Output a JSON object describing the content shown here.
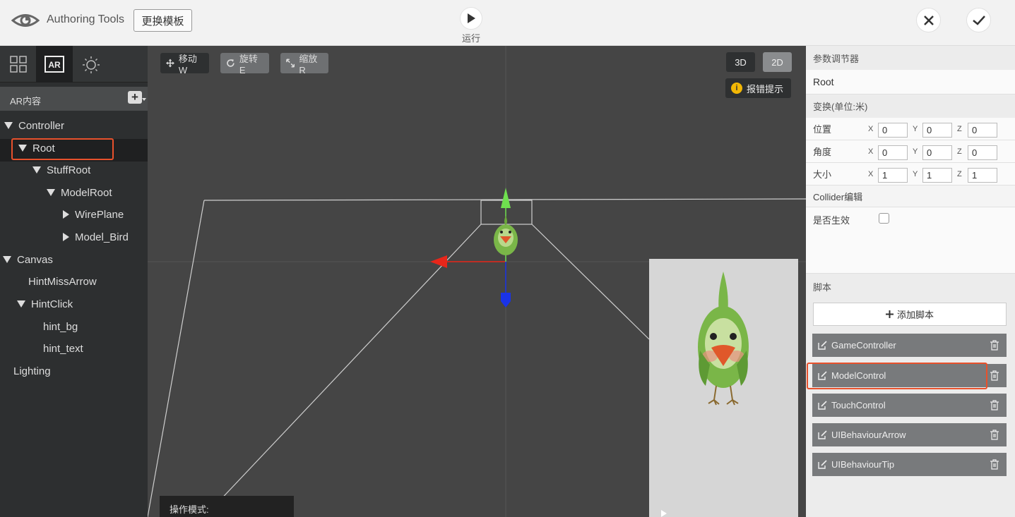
{
  "header": {
    "logo_icon": "eye-logo-icon",
    "app_title": "Authoring Tools",
    "change_template_label": "更换模板",
    "run_label": "运行",
    "close_icon": "close-icon",
    "confirm_icon": "check-icon"
  },
  "left_panel": {
    "tabs": [
      {
        "name": "grid-view-icon"
      },
      {
        "name": "ar-icon",
        "label": "AR",
        "selected": true
      },
      {
        "name": "sun-icon"
      }
    ],
    "section_title": "AR内容",
    "add_icon": "plus-icon",
    "tree": [
      {
        "label": "Controller",
        "expanded": true
      },
      {
        "label": "Root",
        "expanded": true,
        "selected": true
      },
      {
        "label": "StuffRoot",
        "expanded": true
      },
      {
        "label": "ModelRoot",
        "expanded": true
      },
      {
        "label": "WirePlane",
        "expanded": false
      },
      {
        "label": "Model_Bird",
        "expanded": false
      },
      {
        "label": "Canvas",
        "expanded": true
      },
      {
        "label": "HintMissArrow"
      },
      {
        "label": "HintClick",
        "expanded": true
      },
      {
        "label": "hint_bg"
      },
      {
        "label": "hint_text"
      },
      {
        "label": "Lighting"
      }
    ]
  },
  "viewport": {
    "tools": {
      "move": "移动W",
      "rotate": "旋转E",
      "scale": "缩放R"
    },
    "view_3d": "3D",
    "view_2d": "2D",
    "error_hint": "报错提示",
    "warn_icon_text": "i",
    "op_mode_label": "操作模式:"
  },
  "right_panel": {
    "title": "参数调节器",
    "object_name": "Root",
    "transform_title": "变换(单位:米)",
    "rows": {
      "position": {
        "label": "位置",
        "x": "0",
        "y": "0",
        "z": "0"
      },
      "rotation": {
        "label": "角度",
        "x": "0",
        "y": "0",
        "z": "0"
      },
      "scale": {
        "label": "大小",
        "x": "1",
        "y": "1",
        "z": "1"
      }
    },
    "axis_x": "X",
    "axis_y": "Y",
    "axis_z": "Z",
    "collider_title": "Collider编辑",
    "enabled_label": "是否生效",
    "enabled_checked": false,
    "script_title": "脚本",
    "add_script_label": "添加脚本",
    "scripts": [
      {
        "name": "GameController"
      },
      {
        "name": "ModelControl",
        "highlighted": true
      },
      {
        "name": "TouchControl"
      },
      {
        "name": "UIBehaviourArrow"
      },
      {
        "name": "UIBehaviourTip"
      }
    ]
  },
  "colors": {
    "highlight": "#e8512c",
    "gizmo_x": "#e8261a",
    "gizmo_y": "#6fe04f",
    "gizmo_z": "#1a33e8"
  }
}
